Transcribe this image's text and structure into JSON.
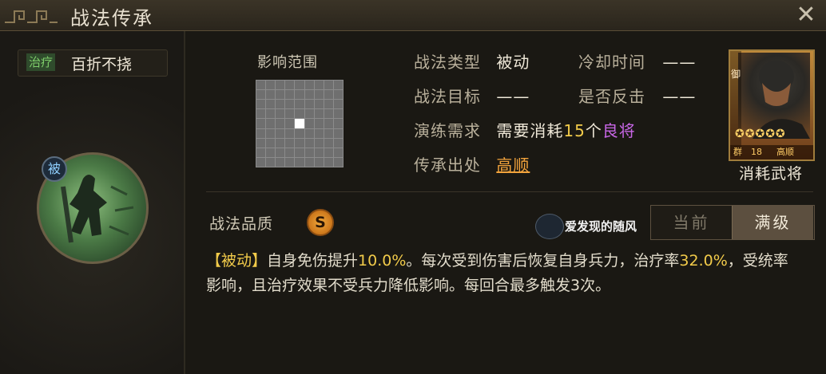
{
  "window": {
    "title": "战法传承",
    "close_label": "✕"
  },
  "skill": {
    "type_tag": "治疗",
    "name": "百折不挠",
    "passive_badge": "被"
  },
  "range": {
    "title": "影响范围",
    "grid_rows": 9,
    "grid_cols": 9,
    "active_cell": [
      4,
      4
    ]
  },
  "info": {
    "type_label": "战法类型",
    "type_value": "被动",
    "cooldown_label": "冷却时间",
    "cooldown_value": "——",
    "target_label": "战法目标",
    "target_value": "——",
    "counter_label": "是否反击",
    "counter_value": "——",
    "drill_label": "演练需求",
    "drill_prefix": "需要消耗",
    "drill_count": "15",
    "drill_unit": "个",
    "drill_quality": "良将",
    "origin_label": "传承出处",
    "origin_value": "高顺"
  },
  "card": {
    "role": "御",
    "stars": "✪✪✪✪✪",
    "faction": "群",
    "cost": "18",
    "name": "高顺",
    "consume_label": "消耗武将"
  },
  "quality": {
    "label": "战法品质",
    "grade": "S"
  },
  "watermark": {
    "text": "爱发现的随风"
  },
  "level_toggle": {
    "current_label": "当前",
    "max_label": "满级"
  },
  "description": {
    "tag": "【被动】",
    "part1": "自身免伤提升",
    "val1": "10.0%",
    "part2": "。每次受到伤害后恢复自身兵力，治疗率",
    "val2": "32.0%",
    "part3": "，受统率影响，且治疗效果不受兵力降低影响。每回合最多触发3次。"
  },
  "colors": {
    "accent_orange": "#f2a33c",
    "highlight_yellow": "#f2cb4a",
    "quality_purple": "#c866e6",
    "heal_green": "#7fcf6b"
  }
}
